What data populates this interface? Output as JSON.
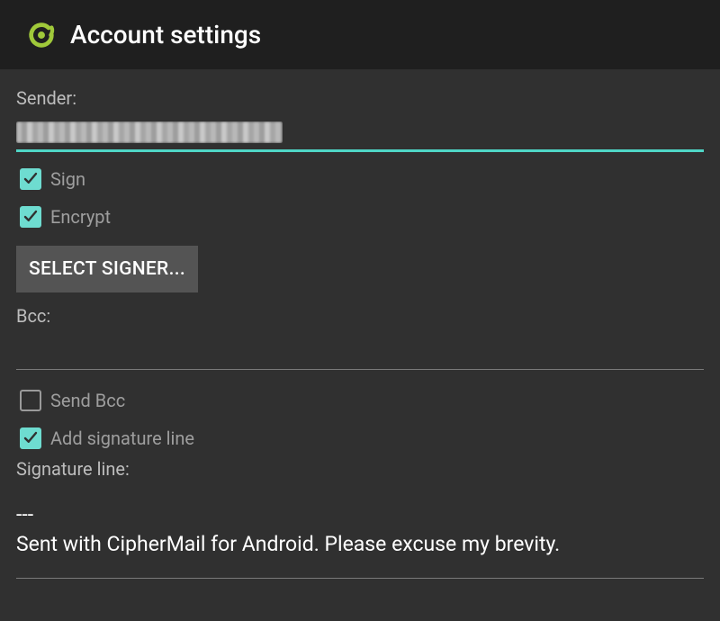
{
  "header": {
    "title": "Account settings"
  },
  "sender": {
    "label": "Sender:",
    "value_redacted": true,
    "sign_label": "Sign",
    "sign_checked": true,
    "encrypt_label": "Encrypt",
    "encrypt_checked": true,
    "select_signer_label": "SELECT SIGNER..."
  },
  "bcc": {
    "label": "Bcc:",
    "value": "",
    "send_bcc_label": "Send Bcc",
    "send_bcc_checked": false,
    "add_sig_label": "Add signature line",
    "add_sig_checked": true
  },
  "signature": {
    "label": "Signature line:",
    "value": "---\nSent with CipherMail for Android. Please excuse my brevity."
  },
  "colors": {
    "accent": "#6edcd0",
    "underline": "#4fd6c6"
  }
}
